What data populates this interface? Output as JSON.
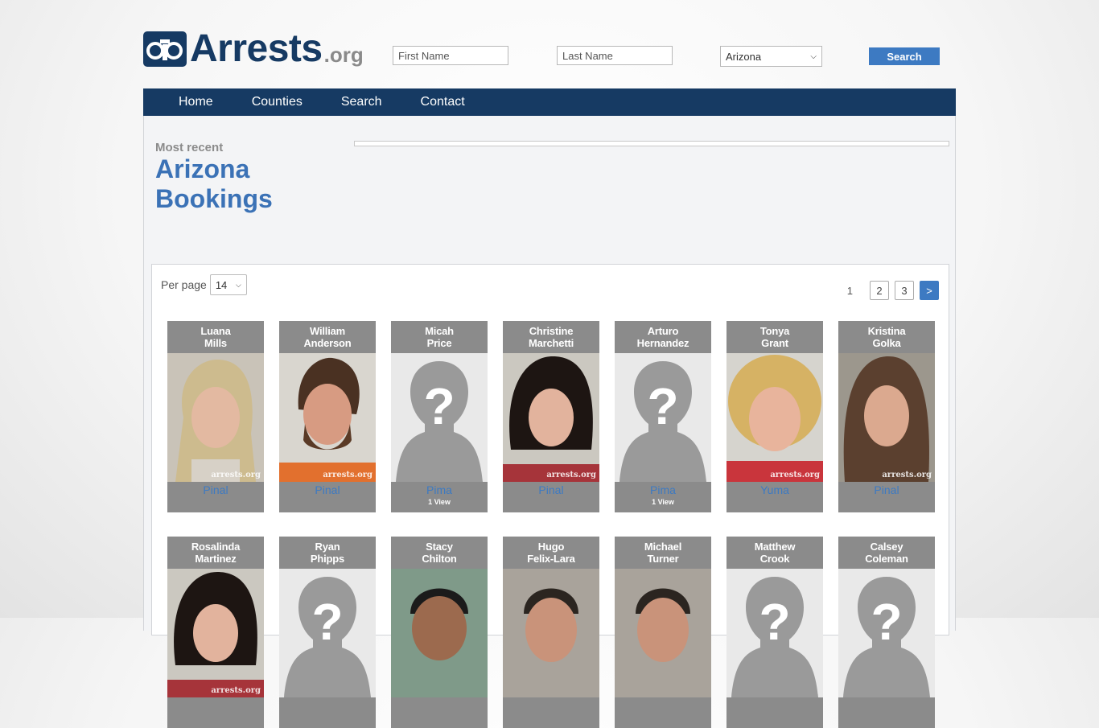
{
  "header": {
    "logo_main": "Arrests",
    "logo_suffix": ".org",
    "first_name_placeholder": "First Name",
    "last_name_placeholder": "Last Name",
    "state_selected": "Arizona",
    "search_label": "Search"
  },
  "nav": {
    "items": [
      "Home",
      "Counties",
      "Search",
      "Contact"
    ]
  },
  "page": {
    "kicker": "Most recent",
    "title": "Arizona Bookings"
  },
  "list": {
    "per_page_label": "Per page",
    "per_page_value": "14",
    "pagination": {
      "current": "1",
      "pages": [
        "2",
        "3"
      ],
      "next": ">"
    },
    "watermark": "arrests.org",
    "people": [
      {
        "first": "Luana",
        "last": "Mills",
        "county": "Pinal",
        "views": "",
        "photo": "woman-blonde"
      },
      {
        "first": "William",
        "last": "Anderson",
        "county": "Pinal",
        "views": "",
        "photo": "man-beard"
      },
      {
        "first": "Micah",
        "last": "Price",
        "county": "Pima",
        "views": "1 View",
        "photo": "placeholder"
      },
      {
        "first": "Christine",
        "last": "Marchetti",
        "county": "Pinal",
        "views": "",
        "photo": "woman-dark"
      },
      {
        "first": "Arturo",
        "last": "Hernandez",
        "county": "Pima",
        "views": "1 View",
        "photo": "placeholder"
      },
      {
        "first": "Tonya",
        "last": "Grant",
        "county": "Yuma",
        "views": "",
        "photo": "woman-curly"
      },
      {
        "first": "Kristina",
        "last": "Golka",
        "county": "Pinal",
        "views": "",
        "photo": "woman-brown"
      },
      {
        "first": "Rosalinda",
        "last": "Martinez",
        "county": "",
        "views": "",
        "photo": "woman-dark"
      },
      {
        "first": "Ryan",
        "last": "Phipps",
        "county": "",
        "views": "",
        "photo": "placeholder"
      },
      {
        "first": "Stacy",
        "last": "Chilton",
        "county": "",
        "views": "",
        "photo": "man-dark"
      },
      {
        "first": "Hugo",
        "last": "Felix-Lara",
        "county": "",
        "views": "",
        "photo": "man-short"
      },
      {
        "first": "Michael",
        "last": "Turner",
        "county": "",
        "views": "",
        "photo": "man-short"
      },
      {
        "first": "Matthew",
        "last": "Crook",
        "county": "",
        "views": "",
        "photo": "placeholder"
      },
      {
        "first": "Calsey",
        "last": "Coleman",
        "county": "",
        "views": "",
        "photo": "placeholder"
      }
    ]
  },
  "colors": {
    "navy": "#163a63",
    "accent": "#3d7ac2",
    "card": "#8b8b8b"
  }
}
